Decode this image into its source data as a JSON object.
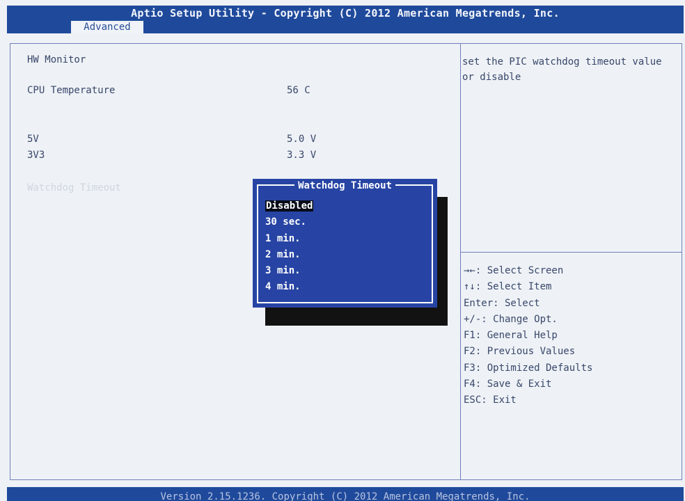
{
  "header": {
    "title": "Aptio Setup Utility - Copyright (C) 2012 American Megatrends, Inc.",
    "active_tab": "Advanced"
  },
  "main": {
    "section_title": "HW Monitor",
    "rows": [
      {
        "label": "CPU Temperature",
        "value": "56 C"
      },
      {
        "label": "5V",
        "value": "5.0 V"
      },
      {
        "label": "3V3",
        "value": "3.3 V"
      }
    ],
    "watchdog_label": "Watchdog Timeout"
  },
  "popup": {
    "title": "Watchdog Timeout",
    "options": [
      "Disabled",
      "30 sec.",
      "1 min.",
      "2 min.",
      "3 min.",
      "4 min."
    ],
    "selected": "Disabled"
  },
  "help": {
    "text": "set the PIC watchdog timeout value or disable"
  },
  "keys": [
    "→←: Select Screen",
    "↑↓: Select Item",
    "Enter: Select",
    "+/-: Change Opt.",
    "F1: General Help",
    "F2: Previous Values",
    "F3: Optimized Defaults",
    "F4: Save & Exit",
    "ESC: Exit"
  ],
  "footer": {
    "text": "Version 2.15.1236. Copyright (C) 2012 American Megatrends, Inc."
  },
  "colors": {
    "header_bg": "#1f4a9c",
    "screen_bg": "#eef2f6",
    "popup_bg": "#2744a4",
    "text": "#38466a"
  }
}
